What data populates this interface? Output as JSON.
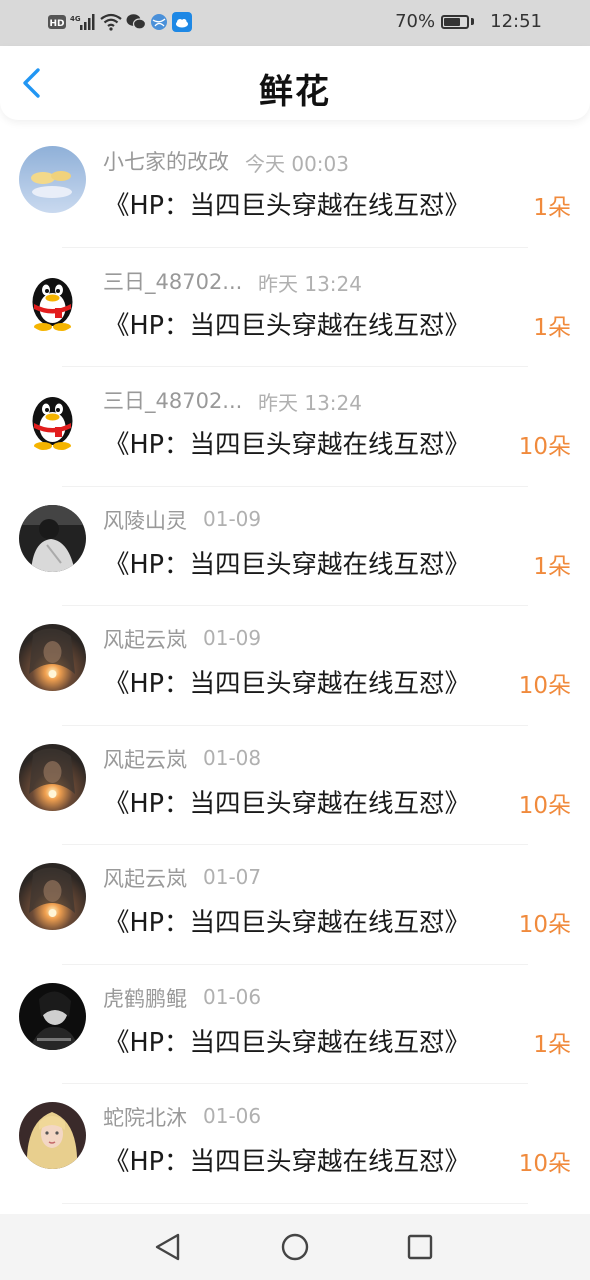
{
  "status_bar": {
    "network_hd": "HD",
    "network_type": "4G",
    "battery_percent": "70%",
    "battery_level": 0.7,
    "time": "12:51",
    "icons": [
      "hd-icon",
      "signal-icon",
      "wifi-icon",
      "wechat-icon",
      "browser-icon",
      "weather-icon"
    ]
  },
  "header": {
    "back_icon": "chevron-left-icon",
    "title": "鲜花"
  },
  "accent_color": "#f08a3c",
  "back_color": "#2196f3",
  "entries": [
    {
      "user": "小七家的改改",
      "time": "今天 00:03",
      "book": "《HP：当四巨头穿越在线互怼》",
      "count": "1朵",
      "avatar": "cloud-avatar"
    },
    {
      "user": "三日_48702...",
      "time": "昨天 13:24",
      "book": "《HP：当四巨头穿越在线互怼》",
      "count": "1朵",
      "avatar": "penguin-avatar"
    },
    {
      "user": "三日_48702...",
      "time": "昨天 13:24",
      "book": "《HP：当四巨头穿越在线互怼》",
      "count": "10朵",
      "avatar": "penguin-avatar"
    },
    {
      "user": "风陵山灵",
      "time": "01-09",
      "book": "《HP：当四巨头穿越在线互怼》",
      "count": "1朵",
      "avatar": "person-avatar"
    },
    {
      "user": "风起云岚",
      "time": "01-09",
      "book": "《HP：当四巨头穿越在线互怼》",
      "count": "10朵",
      "avatar": "glow-avatar"
    },
    {
      "user": "风起云岚",
      "time": "01-08",
      "book": "《HP：当四巨头穿越在线互怼》",
      "count": "10朵",
      "avatar": "glow-avatar"
    },
    {
      "user": "风起云岚",
      "time": "01-07",
      "book": "《HP：当四巨头穿越在线互怼》",
      "count": "10朵",
      "avatar": "glow-avatar"
    },
    {
      "user": "虎鹤鹏鲲",
      "time": "01-06",
      "book": "《HP：当四巨头穿越在线互怼》",
      "count": "1朵",
      "avatar": "dark-portrait-avatar"
    },
    {
      "user": "蛇院北沐",
      "time": "01-06",
      "book": "《HP：当四巨头穿越在线互怼》",
      "count": "10朵",
      "avatar": "blonde-avatar"
    }
  ],
  "nav_bar": {
    "back": "triangle-back-icon",
    "home": "circle-home-icon",
    "recents": "square-recents-icon"
  }
}
